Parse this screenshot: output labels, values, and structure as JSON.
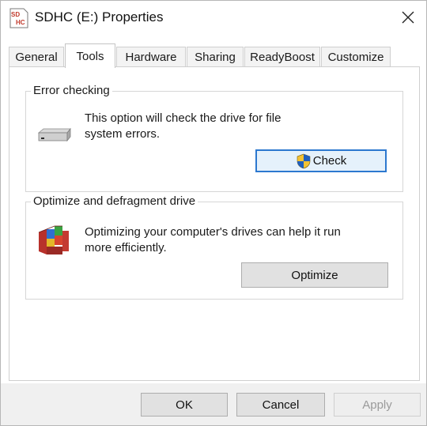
{
  "window": {
    "title": "SDHC (E:) Properties",
    "icon": "sd-card-icon",
    "icon_text_top": "SD",
    "icon_text_bottom": "HC"
  },
  "tabs": [
    {
      "label": "General",
      "active": false
    },
    {
      "label": "Tools",
      "active": true
    },
    {
      "label": "Hardware",
      "active": false
    },
    {
      "label": "Sharing",
      "active": false
    },
    {
      "label": "ReadyBoost",
      "active": false
    },
    {
      "label": "Customize",
      "active": false
    }
  ],
  "error_checking": {
    "heading": "Error checking",
    "icon": "drive-icon",
    "description_line1": "This option will check the drive for file",
    "description_line2": "system errors.",
    "button_label": "Check",
    "button_icon": "uac-shield-icon"
  },
  "optimize": {
    "heading": "Optimize and defragment drive",
    "icon": "defrag-icon",
    "description_line1": "Optimizing your computer's drives can help it run",
    "description_line2": "more efficiently.",
    "button_label": "Optimize"
  },
  "footer": {
    "ok_label": "OK",
    "cancel_label": "Cancel",
    "apply_label": "Apply",
    "apply_enabled": false
  },
  "colors": {
    "highlight": "#d23a2c",
    "focus_border": "#2c78cf",
    "footer_bg": "#f0f0f0"
  }
}
